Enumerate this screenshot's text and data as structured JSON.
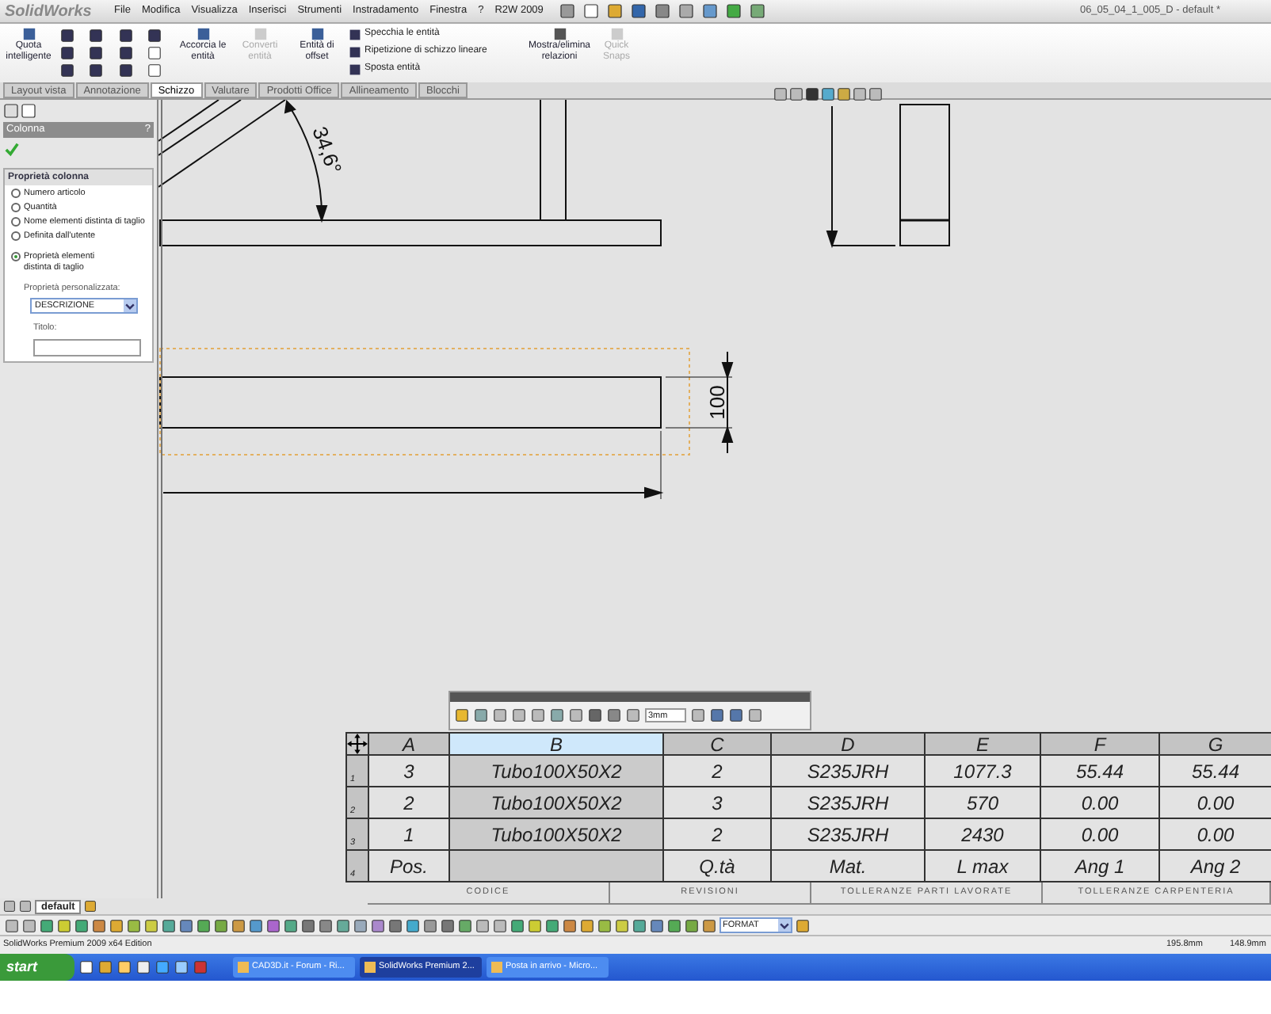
{
  "app": {
    "logo": "SolidWorks",
    "document_title": "06_05_04_1_005_D - default *"
  },
  "menu": [
    "File",
    "Modifica",
    "Visualizza",
    "Inserisci",
    "Strumenti",
    "Instradamento",
    "Finestra",
    "?",
    "R2W 2009"
  ],
  "ribbon": {
    "large_buttons": [
      {
        "label": "Quota intelligente",
        "disabled": false
      },
      {
        "label": "Accorcia le entità",
        "disabled": false
      },
      {
        "label": "Converti entità",
        "disabled": true
      },
      {
        "label": "Entità di offset",
        "disabled": false
      }
    ],
    "commands": [
      "Specchia le entità",
      "Ripetizione di schizzo lineare",
      "Sposta entità"
    ],
    "right_buttons": [
      {
        "label": "Mostra/elimina relazioni",
        "disabled": false
      },
      {
        "label": "Quick Snaps",
        "disabled": true
      }
    ]
  },
  "tabs": [
    {
      "label": "Layout vista",
      "selected": false
    },
    {
      "label": "Annotazione",
      "selected": false
    },
    {
      "label": "Schizzo",
      "selected": true
    },
    {
      "label": "Valutare",
      "selected": false
    },
    {
      "label": "Prodotti Office",
      "selected": false
    },
    {
      "label": "Allineamento",
      "selected": false
    },
    {
      "label": "Blocchi",
      "selected": false
    }
  ],
  "property_manager": {
    "title": "Colonna",
    "help": "?",
    "group_title": "Proprietà colonna",
    "options": [
      {
        "label": "Numero articolo",
        "selected": false
      },
      {
        "label": "Quantità",
        "selected": false
      },
      {
        "label": "Nome elementi distinta di taglio",
        "selected": false
      },
      {
        "label": "Definita dall'utente",
        "selected": false
      },
      {
        "label": "Proprietà elementi distinta di taglio",
        "selected": true
      }
    ],
    "custom_property_label": "Proprietà personalizzata:",
    "custom_property_value": "DESCRIZIONE",
    "title_label": "Titolo:"
  },
  "drawing": {
    "angle_dimension": "34,6°",
    "height_dimension": "100"
  },
  "format_toolbar": {
    "size": "3mm"
  },
  "table": {
    "columns": [
      {
        "label": "A",
        "selected": false
      },
      {
        "label": "B",
        "selected": true
      },
      {
        "label": "C",
        "selected": false
      },
      {
        "label": "D",
        "selected": false
      },
      {
        "label": "E",
        "selected": false
      },
      {
        "label": "F",
        "selected": false
      },
      {
        "label": "G",
        "selected": false
      }
    ],
    "rows": [
      {
        "number": "1",
        "cells": [
          "3",
          "Tubo100X50X2",
          "2",
          "S235JRH",
          "1077.3",
          "55.44",
          "55.44"
        ]
      },
      {
        "number": "2",
        "cells": [
          "2",
          "Tubo100X50X2",
          "3",
          "S235JRH",
          "570",
          "0.00",
          "0.00"
        ]
      },
      {
        "number": "3",
        "cells": [
          "1",
          "Tubo100X50X2",
          "2",
          "S235JRH",
          "2430",
          "0.00",
          "0.00"
        ]
      },
      {
        "number": "4",
        "cells": [
          "Pos.",
          "",
          "Q.tà",
          "Mat.",
          "L max",
          "Ang 1",
          "Ang 2"
        ]
      }
    ]
  },
  "title_block": [
    "CODICE",
    "REVISIONI",
    "TOLLERANZE PARTI LAVORATE",
    "TOLLERANZE CARPENTERIA"
  ],
  "sheet_tabs": [
    {
      "label": "default",
      "selected": true
    }
  ],
  "bottom_toolbar": {
    "layer": "FORMAT"
  },
  "status_bar": {
    "edition": "SolidWorks Premium 2009 x64 Edition",
    "x": "195.8mm",
    "y": "148.9mm"
  },
  "taskbar": {
    "start": "start",
    "items": [
      {
        "label": "CAD3D.it - Forum - Ri...",
        "selected": false
      },
      {
        "label": "SolidWorks Premium 2...",
        "selected": true
      },
      {
        "label": "Posta in arrivo - Micro...",
        "selected": false
      }
    ]
  }
}
